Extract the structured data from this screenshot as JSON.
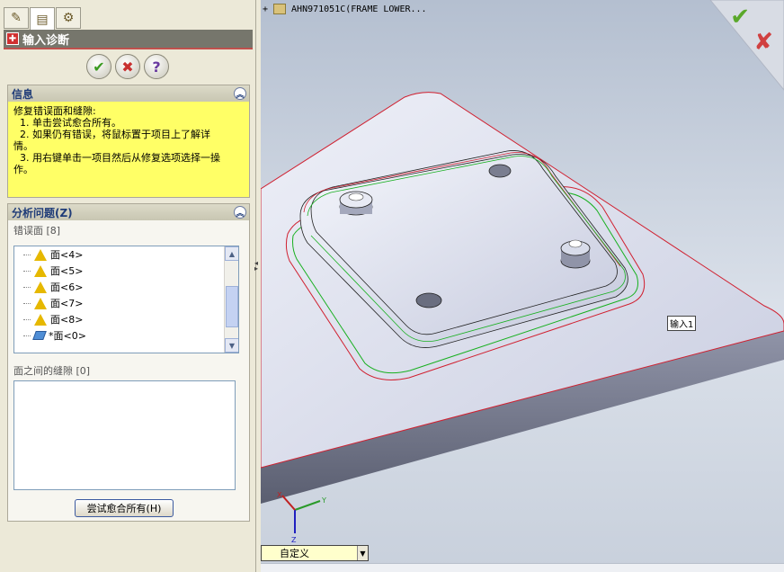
{
  "property_manager": {
    "tabs": [
      {
        "icon": "feature-manager-icon"
      },
      {
        "icon": "property-manager-icon"
      },
      {
        "icon": "configuration-manager-icon"
      }
    ],
    "title": "输入诊断",
    "buttons": {
      "ok": "✔",
      "cancel": "✖",
      "help": "?"
    }
  },
  "info": {
    "title": "信息",
    "lines": [
      "修复错误面和缝隙:",
      "  1. 单击尝试愈合所有。",
      "  2. 如果仍有错误，将鼠标置于项目上了解详",
      "情。",
      "  3. 用右键单击一项目然后从修复选项选择一操",
      "作。"
    ]
  },
  "analysis": {
    "title": "分析问题(Z)",
    "faulty_faces_label": "错误面 [8]",
    "faces": [
      "面<4>",
      "面<5>",
      "面<6>",
      "面<7>",
      "面<8>",
      "*面<0>"
    ],
    "gaps_label": "面之间的缝隙 [0]",
    "try_heal_button": "尝试愈合所有(H)"
  },
  "viewport": {
    "tree_root": "AHN971051C(FRAME LOWER...",
    "tree_expander": "+",
    "callout": "输入1",
    "view_orientation": "自定义",
    "triad_axes": {
      "x": "X",
      "y": "Y",
      "z": "Z"
    },
    "colors": {
      "edge_highlight": "#d02030",
      "edge_selected": "#18b020",
      "accept": "#5aa82a",
      "reject": "#d04040"
    }
  }
}
